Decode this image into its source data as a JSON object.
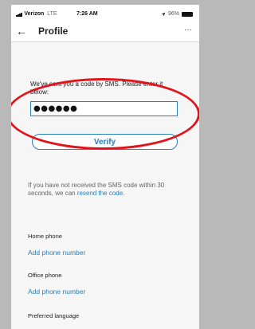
{
  "status_bar": {
    "carrier": "Verizon",
    "network": "LTE",
    "time": "7:26 AM",
    "battery": "96%"
  },
  "header": {
    "title": "Profile",
    "more": "…"
  },
  "verification": {
    "message": "We've sent you a code by SMS. Please enter it below:",
    "code_value": "●●●●●●",
    "verify_label": "Verify",
    "resend_text": "If you have not received the SMS code within 30 seconds, we can ",
    "resend_link": "resend the code."
  },
  "fields": [
    {
      "label": "Home phone",
      "action": "Add phone number"
    },
    {
      "label": "Office phone",
      "action": "Add phone number"
    },
    {
      "label": "Preferred language"
    }
  ],
  "colors": {
    "accent": "#2a7fb6",
    "annotation": "#e3131c"
  },
  "icons": [
    "signal-icon",
    "location-arrow-icon",
    "battery-icon",
    "back-arrow-icon",
    "more-icon"
  ]
}
